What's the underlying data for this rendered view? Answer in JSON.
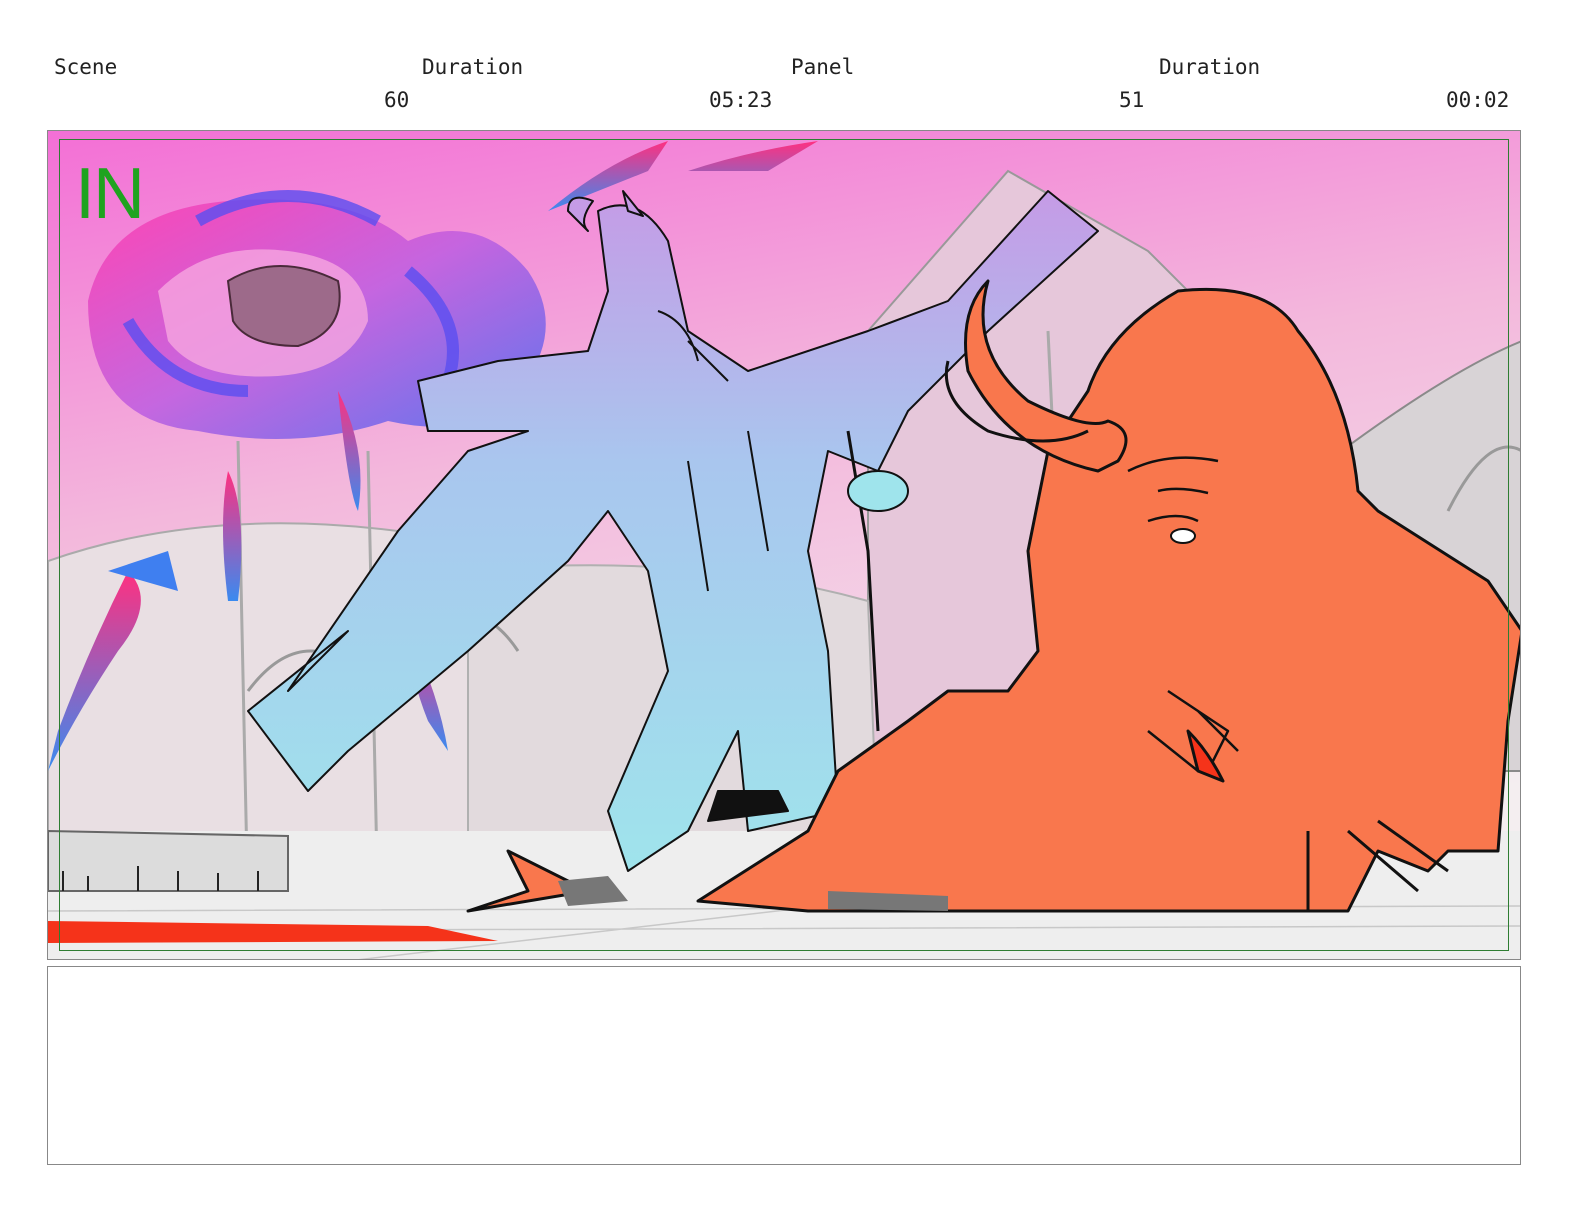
{
  "header": {
    "scene_label": "Scene",
    "scene_duration_label": "Duration",
    "panel_label": "Panel",
    "panel_duration_label": "Duration",
    "scene_number": "60",
    "scene_duration": "05:23",
    "panel_number": "51",
    "panel_duration": "00:02"
  },
  "panel": {
    "marker": "IN",
    "colors": {
      "sky_top": "#f36fd6",
      "sky_bottom": "#f7e3ea",
      "demon_orange": "#f9774d",
      "ghost_cyan": "#9fe4ec",
      "safe_frame": "#2e7d32",
      "marker_green": "#1fa31f"
    }
  },
  "notes": {
    "text": ""
  }
}
